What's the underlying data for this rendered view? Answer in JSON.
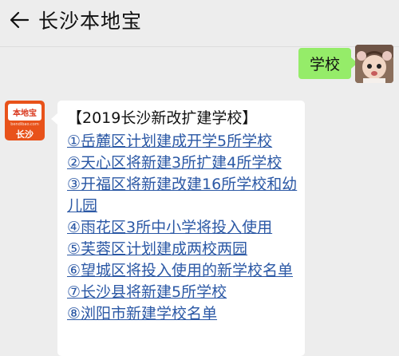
{
  "header": {
    "title": "长沙本地宝",
    "back_icon": "back-arrow-icon"
  },
  "outgoing": {
    "text": "学校",
    "bubble_color": "#95ec69"
  },
  "incoming": {
    "avatar": {
      "brand": "本地宝",
      "sub": "bendibao.com",
      "city": "长沙",
      "color": "#e8521a"
    },
    "heading": "【2019长沙新改扩建学校】",
    "link_color": "#2b58a5",
    "items": [
      "①岳麓区计划建成开学5所学校",
      "②天心区将新建3所扩建4所学校",
      "③开福区将新建改建16所学校和幼儿园",
      "④雨花区3所中小学将投入使用",
      "⑤芙蓉区计划建成两校两园",
      "⑥望城区将投入使用的新学校名单",
      "⑦长沙县将新建5所学校",
      "⑧浏阳市新建学校名单"
    ]
  }
}
